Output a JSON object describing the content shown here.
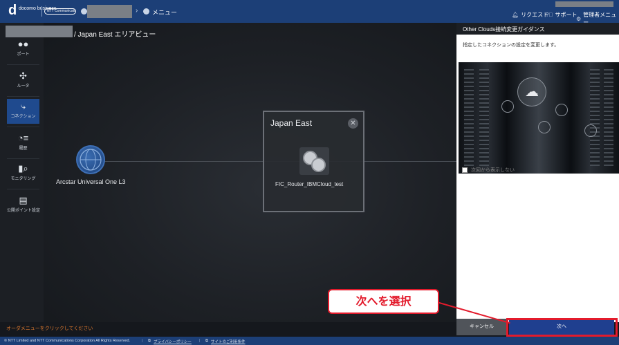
{
  "header": {
    "logo_mark": "d",
    "logo_text": "docomo business",
    "ntt_logo": "NTT Communications",
    "menu_label": "メニュー",
    "links": [
      {
        "icon": "bell-icon",
        "label": "リクエスト"
      },
      {
        "icon": "help-icon",
        "label": "サポート"
      },
      {
        "icon": "gear-icon",
        "label": "管理者メニュー"
      }
    ]
  },
  "sidebar": {
    "items": [
      {
        "label": "ポート",
        "icon": "port-icon"
      },
      {
        "label": "ルータ",
        "icon": "router-icon"
      },
      {
        "label": "コネクション",
        "icon": "connection-icon",
        "active": true
      },
      {
        "label": "履歴",
        "icon": "history-icon"
      },
      {
        "label": "モニタリング",
        "icon": "monitoring-icon"
      },
      {
        "label": "公開ポイント設定",
        "icon": "public-point-icon"
      }
    ]
  },
  "main": {
    "breadcrumb": "/ Japan East エリアビュー",
    "arcstar_label": "Arcstar Universal One L3",
    "area_title": "Japan East",
    "router_label": "FIC_Router_IBMCloud_test",
    "order_hint": "オーダメニューをクリックしてください"
  },
  "panel": {
    "title": "Other Clouds接続変更ガイダンス",
    "description": "指定したコネクションの設定を変更します。",
    "checkbox_label": "次回から表示しない",
    "cancel_label": "キャンセル",
    "next_label": "次へ"
  },
  "annotation": {
    "callout_text": "次へを選択"
  },
  "footer": {
    "copyright": "© NTT Limited and NTT Communications Corporation All Rights Reserved.",
    "privacy": "プライバシーポリシー",
    "terms": "サイトのご利用条件"
  }
}
